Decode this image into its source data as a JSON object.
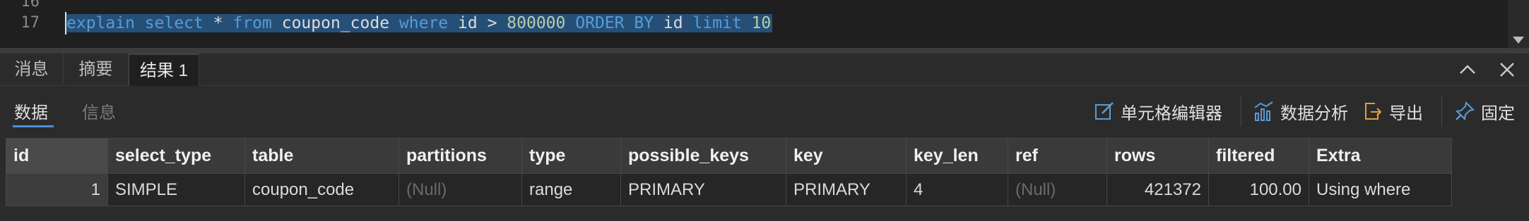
{
  "editor": {
    "line_numbers": [
      "16",
      "17"
    ],
    "code": {
      "explain": "explain",
      "select": "select",
      "star": "*",
      "from": "from",
      "table": "coupon_code",
      "where": "where",
      "col": "id",
      "gt": ">",
      "value": "800000",
      "order_by": "ORDER BY",
      "order_col": "id",
      "limit": "limit",
      "limit_val": "10"
    }
  },
  "tabs": [
    {
      "label": "消息"
    },
    {
      "label": "摘要"
    },
    {
      "label": "结果 1"
    }
  ],
  "toolbar": {
    "subtabs": [
      {
        "label": "数据"
      },
      {
        "label": "信息"
      }
    ],
    "cell_editor": "单元格编辑器",
    "data_analysis": "数据分析",
    "export": "导出",
    "pin": "固定"
  },
  "grid": {
    "columns": [
      "id",
      "select_type",
      "table",
      "partitions",
      "type",
      "possible_keys",
      "key",
      "key_len",
      "ref",
      "rows",
      "filtered",
      "Extra"
    ],
    "rows": [
      [
        "1",
        "SIMPLE",
        "coupon_code",
        "(Null)",
        "range",
        "PRIMARY",
        "PRIMARY",
        "4",
        "(Null)",
        "421372",
        "100.00",
        "Using where"
      ]
    ]
  },
  "colors": {
    "selection": "#264f78",
    "keyword": "#569cd6",
    "number": "#b5cea8",
    "accent": "#4a90d9"
  }
}
